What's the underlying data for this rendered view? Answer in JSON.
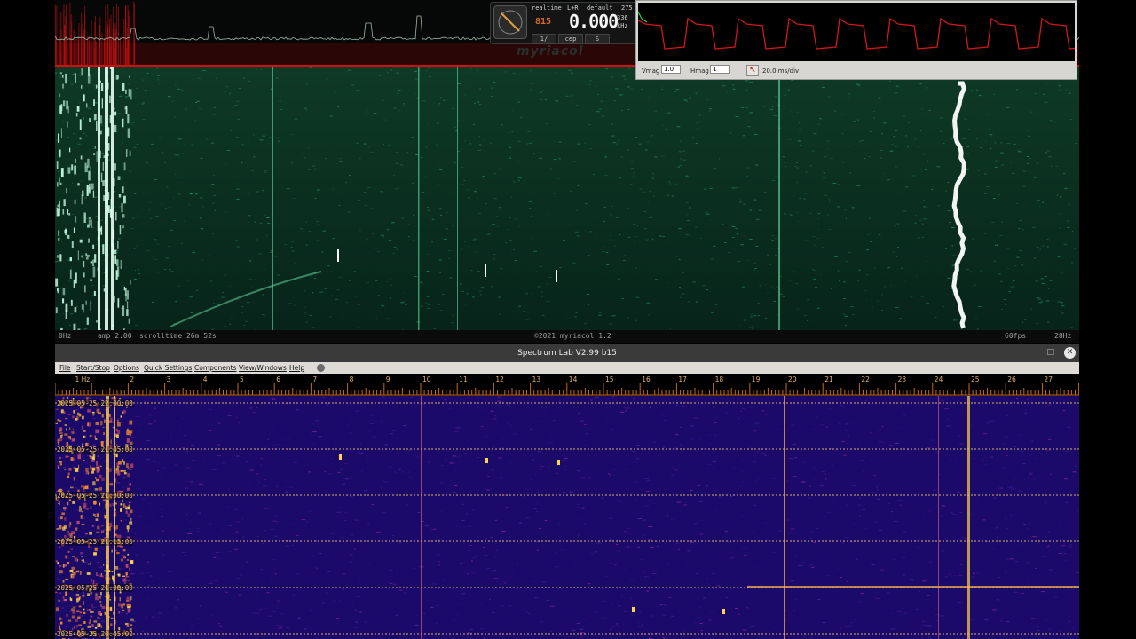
{
  "top_window": {
    "status_left_freq": "0Hz",
    "status_amp": "amp 2.00",
    "status_scrolltime": "scrolltime 26m 52s",
    "status_copyright": "©2021 myriacol 1.2",
    "status_fps": "60fps",
    "status_right_freq": "28Hz",
    "brand": "myriacol",
    "meter": {
      "mode": "realtime",
      "channel": "L+R",
      "preset": "default",
      "count": "275",
      "small_digits": "815",
      "frequency": "0.000",
      "frequency_sub": "336",
      "unit": "kHz",
      "buttons": [
        "1/",
        "cep",
        "S"
      ]
    }
  },
  "oscilloscope": {
    "vmag_label": "Vmag",
    "vmag_value": "1.0",
    "hmag_label": "Hmag",
    "hmag_value": "1",
    "timebase": "20.0 ms/div",
    "trace_color": "#d01818"
  },
  "spectrum_lab": {
    "title": "Spectrum Lab V2.99 b15",
    "minimize_glyph": "□",
    "close_glyph": "✕",
    "menu": [
      "File",
      "Start/Stop",
      "Options",
      "Quick Settings",
      "Components",
      "View/Windows",
      "Help"
    ],
    "scale_labels": [
      "1 Hz",
      "2",
      "3",
      "4",
      "5",
      "6",
      "7",
      "8",
      "9",
      "10",
      "11",
      "12",
      "13",
      "14",
      "15",
      "16",
      "17",
      "18",
      "19",
      "20",
      "21",
      "22",
      "23",
      "24",
      "25",
      "26",
      "27"
    ],
    "timestamps": [
      "2025-05-25 22:00:00",
      "2025-05-25 21:45:00",
      "2025-05-25 21:30:00",
      "2025-05-25 21:15:00",
      "2025-05-25 21:00:00",
      "2025-05-25 20:45:00"
    ]
  },
  "colors": {
    "waterfall_green_bg": "#0a2a1c",
    "waterfall_purple_bg": "#1c0a6a",
    "hot_yellow": "#ffd64a",
    "timestamp_line": "#e9c46a",
    "scale_tick": "#c96a1a"
  }
}
